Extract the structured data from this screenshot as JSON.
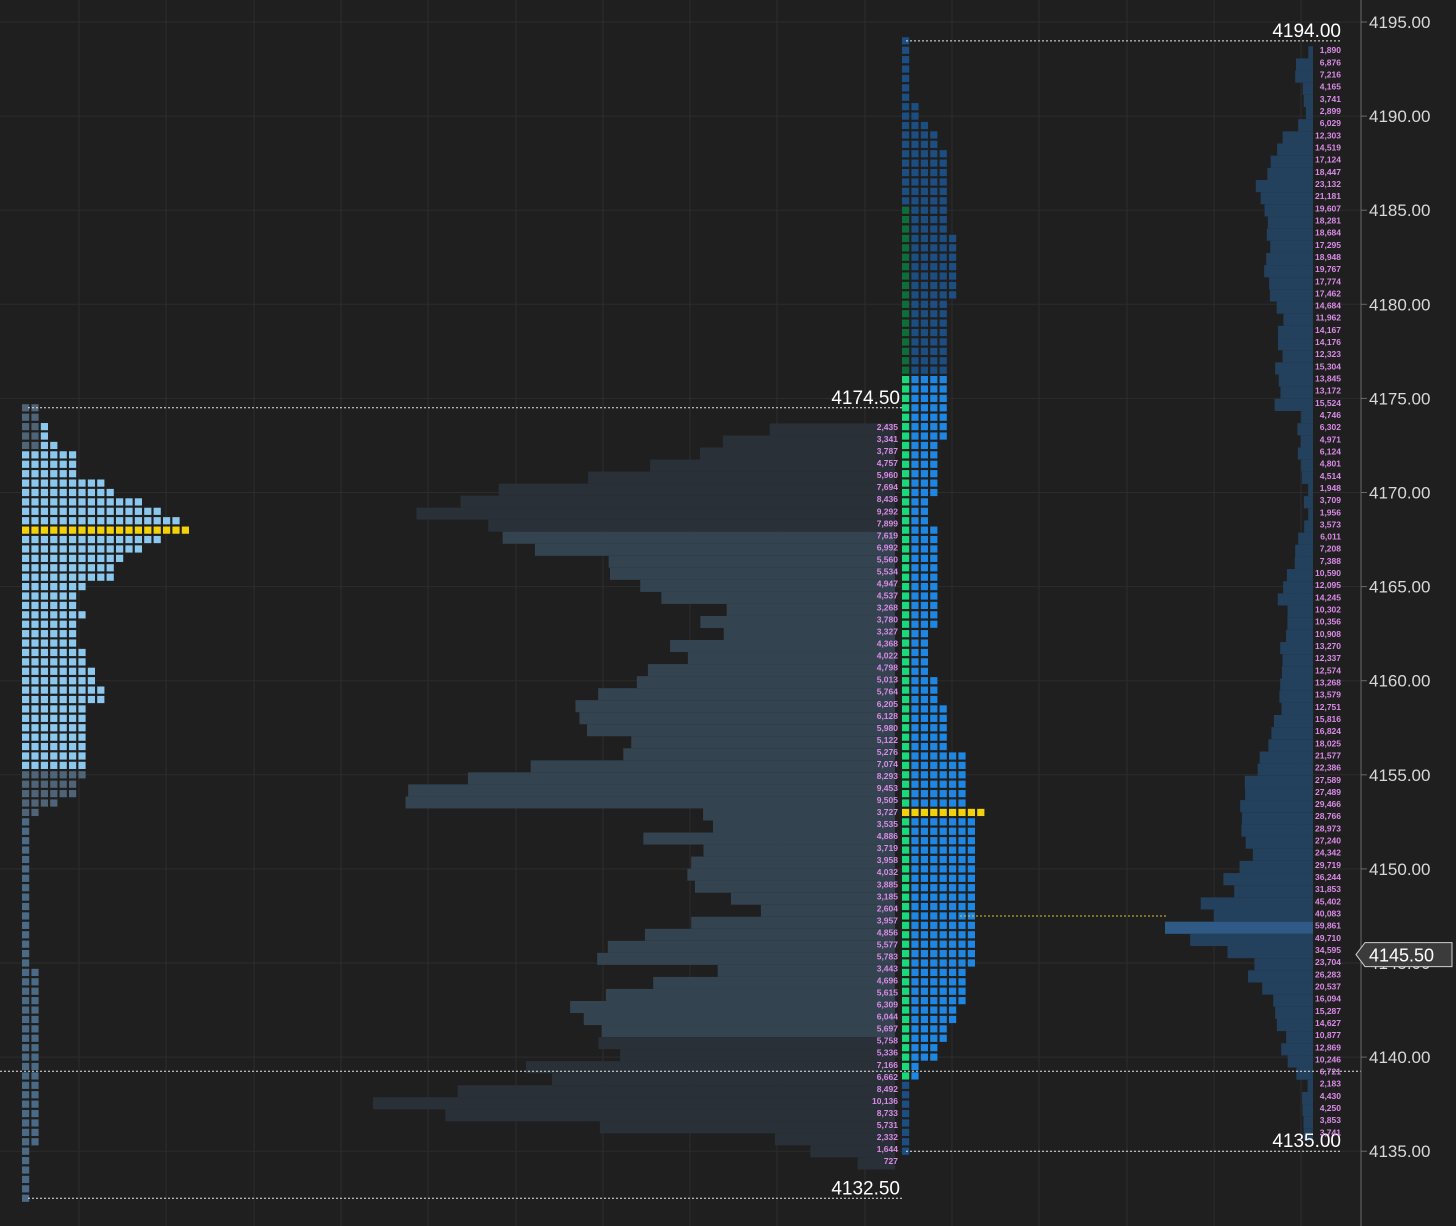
{
  "colors": {
    "background": "#1f1f1f",
    "grid": "#2c2c2c",
    "axis_text": "#d8d8d8",
    "axis_line": "#6a6a6a",
    "ref_line": "#e6e6e6",
    "ref_label": "#ffffff",
    "poc": "#f2d20a",
    "tpo_value_area": "#8cc8ee",
    "tpo_outside": "#4f6477",
    "tpo_tail": "#4a6a86",
    "volume_value_area": "#344350",
    "volume_outside": "#2a3038",
    "session_tpo_blue": "#1f86e2",
    "session_tpo_dark": "#1d4e82",
    "initial_balance_green": "#19d97a",
    "initial_balance_dark_green": "#0e6e3a",
    "right_profile": "#23405d",
    "right_profile_poc": "#2f5a86",
    "current_price_line": "#d4c43a",
    "volume_labels": "#d98be6",
    "price_box_bg": "#3b3b3b",
    "price_box_border": "#cfcfcf",
    "price_box_text": "#ffffff"
  },
  "price_axis": {
    "labels": [
      "4195.00",
      "4190.00",
      "4185.00",
      "4180.00",
      "4175.00",
      "4170.00",
      "4165.00",
      "4160.00",
      "4155.00",
      "4150.00",
      "4145.00",
      "4140.00",
      "4135.00"
    ]
  },
  "current_price": "4145.50",
  "icons": {
    "price_marker": "left-pointing-arrow-icon"
  },
  "chart_data": [
    {
      "type": "bar",
      "name": "prior-session TPO profile",
      "orientation": "horizontal",
      "tick_size": 0.5,
      "high": 4174.5,
      "low": 4132.5,
      "poc": 4168.0,
      "value_area": [
        4155.5,
        4174.0
      ],
      "reference_labels": [
        "4174.50",
        "4132.50"
      ],
      "tpo_counts": [
        {
          "from": 4174.0,
          "to": 4174.5,
          "count": 2
        },
        {
          "from": 4173.0,
          "to": 4173.5,
          "count": 3
        },
        {
          "from": 4172.5,
          "to": 4172.5,
          "count": 4
        },
        {
          "from": 4171.0,
          "to": 4172.0,
          "count": 6
        },
        {
          "from": 4170.5,
          "to": 4170.5,
          "count": 9
        },
        {
          "from": 4170.0,
          "to": 4170.0,
          "count": 10
        },
        {
          "from": 4169.5,
          "to": 4169.5,
          "count": 13
        },
        {
          "from": 4169.0,
          "to": 4169.0,
          "count": 15
        },
        {
          "from": 4168.5,
          "to": 4168.5,
          "count": 17
        },
        {
          "from": 4168.0,
          "to": 4168.0,
          "count": 18
        },
        {
          "from": 4167.5,
          "to": 4167.5,
          "count": 15
        },
        {
          "from": 4167.0,
          "to": 4167.0,
          "count": 13
        },
        {
          "from": 4166.5,
          "to": 4166.5,
          "count": 11
        },
        {
          "from": 4165.5,
          "to": 4166.0,
          "count": 10
        },
        {
          "from": 4165.0,
          "to": 4165.0,
          "count": 7
        },
        {
          "from": 4164.0,
          "to": 4164.5,
          "count": 6
        },
        {
          "from": 4163.5,
          "to": 4163.5,
          "count": 7
        },
        {
          "from": 4162.0,
          "to": 4163.0,
          "count": 6
        },
        {
          "from": 4161.0,
          "to": 4161.5,
          "count": 7
        },
        {
          "from": 4160.0,
          "to": 4160.5,
          "count": 8
        },
        {
          "from": 4159.0,
          "to": 4159.5,
          "count": 9
        },
        {
          "from": 4158.0,
          "to": 4158.5,
          "count": 7
        },
        {
          "from": 4157.0,
          "to": 4157.5,
          "count": 7
        },
        {
          "from": 4156.0,
          "to": 4156.5,
          "count": 7
        },
        {
          "from": 4155.5,
          "to": 4155.5,
          "count": 7
        },
        {
          "from": 4155.0,
          "to": 4155.0,
          "count": 7
        },
        {
          "from": 4154.0,
          "to": 4154.5,
          "count": 6
        },
        {
          "from": 4153.5,
          "to": 4153.5,
          "count": 4
        },
        {
          "from": 4153.0,
          "to": 4153.0,
          "count": 2
        },
        {
          "from": 4145.0,
          "to": 4152.5,
          "count": 1
        },
        {
          "from": 4135.5,
          "to": 4144.5,
          "count": 2
        },
        {
          "from": 4132.5,
          "to": 4135.0,
          "count": 1
        }
      ]
    },
    {
      "type": "bar",
      "name": "prior-session volume profile",
      "orientation": "horizontal",
      "price_range": [
        4132.5,
        4174.5
      ],
      "volume_labels": [
        "2,435",
        "3,341",
        "3,787",
        "4,757",
        "5,960",
        "7,694",
        "8,436",
        "9,292",
        "7,899",
        "7,619",
        "6,992",
        "5,560",
        "5,534",
        "4,947",
        "4,537",
        "3,268",
        "3,780",
        "3,327",
        "4,368",
        "4,022",
        "4,798",
        "5,013",
        "5,764",
        "6,205",
        "6,128",
        "5,980",
        "5,122",
        "5,276",
        "7,074",
        "8,293",
        "9,453",
        "9,505",
        "3,727",
        "3,535",
        "4,886",
        "3,719",
        "3,958",
        "4,032",
        "3,885",
        "3,185",
        "2,604",
        "3,957",
        "4,856",
        "5,577",
        "5,783",
        "3,443",
        "4,696",
        "5,615",
        "6,309",
        "6,044",
        "5,697",
        "5,758",
        "5,336",
        "7,166",
        "6,662",
        "8,492",
        "10,136",
        "8,733",
        "5,731",
        "2,332",
        "1,644",
        "727"
      ]
    },
    {
      "type": "bar",
      "name": "current-session TPO profile",
      "orientation": "horizontal",
      "tick_size": 0.5,
      "high": 4194.0,
      "low": 4135.0,
      "poc": 4153.0,
      "value_area": [
        4139.0,
        4176.0
      ],
      "reference_labels": [
        "4194.00",
        "4135.00"
      ],
      "tpo_counts": [
        {
          "from": 4193.5,
          "to": 4194.0,
          "count": 1
        },
        {
          "from": 4191.0,
          "to": 4193.0,
          "count": 1
        },
        {
          "from": 4190.0,
          "to": 4190.5,
          "count": 2
        },
        {
          "from": 4189.5,
          "to": 4189.5,
          "count": 3
        },
        {
          "from": 4188.5,
          "to": 4189.0,
          "count": 4
        },
        {
          "from": 4187.5,
          "to": 4188.0,
          "count": 5
        },
        {
          "from": 4185.5,
          "to": 4187.0,
          "count": 5
        },
        {
          "from": 4184.0,
          "to": 4185.0,
          "count": 5
        },
        {
          "from": 4183.0,
          "to": 4183.5,
          "count": 6
        },
        {
          "from": 4181.5,
          "to": 4182.5,
          "count": 6
        },
        {
          "from": 4180.5,
          "to": 4181.0,
          "count": 6
        },
        {
          "from": 4179.5,
          "to": 4180.0,
          "count": 5
        },
        {
          "from": 4178.0,
          "to": 4179.0,
          "count": 5
        },
        {
          "from": 4176.0,
          "to": 4177.5,
          "count": 5
        },
        {
          "from": 4173.0,
          "to": 4175.5,
          "count": 5
        },
        {
          "from": 4170.0,
          "to": 4172.5,
          "count": 4
        },
        {
          "from": 4168.5,
          "to": 4169.5,
          "count": 3
        },
        {
          "from": 4166.5,
          "to": 4168.0,
          "count": 4
        },
        {
          "from": 4164.0,
          "to": 4166.0,
          "count": 4
        },
        {
          "from": 4163.0,
          "to": 4163.5,
          "count": 4
        },
        {
          "from": 4160.5,
          "to": 4162.5,
          "count": 3
        },
        {
          "from": 4159.0,
          "to": 4160.0,
          "count": 4
        },
        {
          "from": 4156.5,
          "to": 4158.5,
          "count": 5
        },
        {
          "from": 4155.0,
          "to": 4156.0,
          "count": 7
        },
        {
          "from": 4153.5,
          "to": 4154.5,
          "count": 7
        },
        {
          "from": 4153.0,
          "to": 4153.0,
          "count": 9
        },
        {
          "from": 4147.5,
          "to": 4152.5,
          "count": 8
        },
        {
          "from": 4146.5,
          "to": 4147.0,
          "count": 8
        },
        {
          "from": 4145.0,
          "to": 4146.0,
          "count": 8
        },
        {
          "from": 4143.0,
          "to": 4144.5,
          "count": 7
        },
        {
          "from": 4142.0,
          "to": 4142.5,
          "count": 6
        },
        {
          "from": 4141.0,
          "to": 4141.5,
          "count": 5
        },
        {
          "from": 4140.0,
          "to": 4140.5,
          "count": 4
        },
        {
          "from": 4139.0,
          "to": 4139.5,
          "count": 2
        },
        {
          "from": 4135.0,
          "to": 4138.5,
          "count": 1
        }
      ]
    },
    {
      "type": "bar",
      "name": "current-session volume profile",
      "orientation": "horizontal",
      "price_range": [
        4135.0,
        4194.0
      ],
      "volume_labels": [
        "1,890",
        "6,876",
        "7,216",
        "4,165",
        "3,741",
        "2,899",
        "6,029",
        "12,303",
        "14,519",
        "17,124",
        "18,447",
        "23,132",
        "21,181",
        "19,607",
        "18,281",
        "18,684",
        "17,295",
        "18,948",
        "19,767",
        "17,774",
        "17,462",
        "14,684",
        "11,962",
        "14,167",
        "14,176",
        "12,323",
        "15,304",
        "13,845",
        "13,172",
        "15,524",
        "4,746",
        "6,302",
        "4,971",
        "6,124",
        "4,801",
        "4,514",
        "1,948",
        "3,709",
        "1,956",
        "3,573",
        "6,011",
        "7,208",
        "7,388",
        "10,590",
        "12,095",
        "14,245",
        "10,302",
        "10,356",
        "10,908",
        "13,270",
        "12,337",
        "12,574",
        "13,268",
        "13,579",
        "12,751",
        "15,816",
        "16,824",
        "18,025",
        "21,577",
        "22,386",
        "27,589",
        "27,489",
        "29,466",
        "28,766",
        "28,973",
        "27,240",
        "24,342",
        "29,719",
        "36,244",
        "31,853",
        "45,402",
        "40,083",
        "59,861",
        "49,710",
        "34,595",
        "23,704",
        "26,283",
        "20,537",
        "16,094",
        "15,287",
        "14,627",
        "10,877",
        "12,869",
        "10,246",
        "6,721",
        "2,183",
        "4,430",
        "4,250",
        "3,853",
        "3,741"
      ]
    }
  ]
}
